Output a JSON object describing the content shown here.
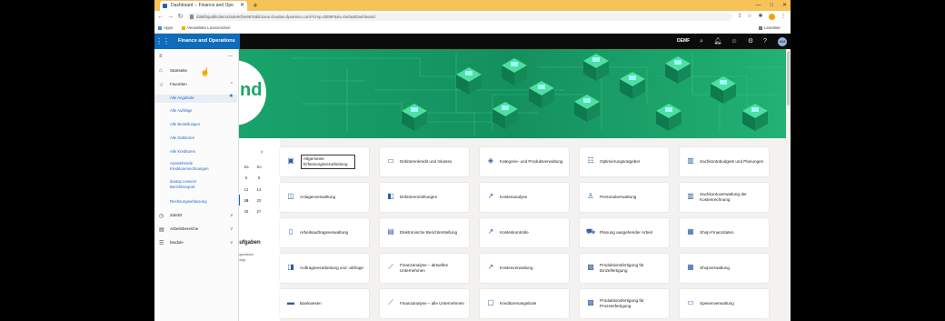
{
  "browser": {
    "tab_title": "Dashboard -- Finance and Ope",
    "new_tab": "+",
    "url": "d365fopublicdemo2a4e9cf4e9576ddc2aos.cloudax.dynamics.com/?cmp=DEMF&mi=DefaultDashboard",
    "bookmarks": [
      "Apps",
      "Verwaltete Lesezeichen"
    ],
    "reading_list": "Leseliste"
  },
  "app": {
    "title": "Finance and Operations",
    "company": "DEMF",
    "user_initials": "MM"
  },
  "nav": {
    "home": "Startseite",
    "favorites": "Favoriten",
    "favorite_items": [
      "Alle Angebote",
      "Alle Aufträge",
      "Alle Bestellungen",
      "Alle Debitoren",
      "Alle Kreditoren",
      "Ausstehende Kreditorenrechnungen",
      "dustop connect Berichtsexport",
      "Rechnungserfassung"
    ],
    "recent": "Zuletzt",
    "workspaces": "Arbeitsbereiche",
    "modules": "Module"
  },
  "banner": {
    "partial_text": "nd"
  },
  "calendar": {
    "next": "›",
    "day_headers": [
      "Sa",
      "So"
    ],
    "rows": [
      [
        "5",
        "6"
      ],
      [
        "12",
        "13"
      ],
      [
        "19",
        "20"
      ],
      [
        "26",
        "27"
      ]
    ]
  },
  "tasks": {
    "heading": "aufgaben",
    "line1": "ugewiesen",
    "line2": "zeigt."
  },
  "tiles": [
    {
      "label": "Allgemeine Erfassungsverarbeitung",
      "icon": "journal-icon"
    },
    {
      "label": "Debitorenkredit und Inkasso",
      "icon": "credit-icon"
    },
    {
      "label": "Kategorie- und Produktverwaltung",
      "icon": "box-icon"
    },
    {
      "label": "Optimierungsratgeber",
      "icon": "list-icon"
    },
    {
      "label": "Sachkontobudgets und Planungen",
      "icon": "chart-icon"
    },
    {
      "label": "Anlagenverwaltung",
      "icon": "asset-icon"
    },
    {
      "label": "Debitorenzahlungen",
      "icon": "payment-icon"
    },
    {
      "label": "Kostenanalyse",
      "icon": "trend-icon"
    },
    {
      "label": "Personalverwaltung",
      "icon": "people-icon"
    },
    {
      "label": "Sachkontoverwaltung der Kostenrechnung",
      "icon": "chart-icon"
    },
    {
      "label": "Arbeitsauftragsverwaltung",
      "icon": "clipboard-icon"
    },
    {
      "label": "Elektronische Berichterstellung",
      "icon": "report-icon"
    },
    {
      "label": "Kostenkontrolle",
      "icon": "trend-icon"
    },
    {
      "label": "Planung ausgehender Arbeit",
      "icon": "truck-icon"
    },
    {
      "label": "Shop-Finanzdaten",
      "icon": "store-icon"
    },
    {
      "label": "Auftragsverarbeitung und -abfrage",
      "icon": "order-icon"
    },
    {
      "label": "Finanzanalyse – aktuelles Unternehmen",
      "icon": "analysis-icon"
    },
    {
      "label": "Kostenverwaltung",
      "icon": "trend-icon"
    },
    {
      "label": "Produktionsfertigung für Einzelfertigung",
      "icon": "factory-icon"
    },
    {
      "label": "Shopverwaltung",
      "icon": "store-icon"
    },
    {
      "label": "Bankwesen",
      "icon": "bank-icon"
    },
    {
      "label": "Finanzanalyse – alle Unternehmen",
      "icon": "analysis-icon"
    },
    {
      "label": "Kreditorenangebote",
      "icon": "quote-icon"
    },
    {
      "label": "Produktionsfertigung für Prozessfertigung",
      "icon": "factory-icon"
    },
    {
      "label": "Spesenverwaltung",
      "icon": "expense-icon"
    }
  ],
  "colors": {
    "brand_blue": "#0f6cbd",
    "banner_green": "#1aa86a",
    "chrome_orange": "#f6c35a"
  }
}
